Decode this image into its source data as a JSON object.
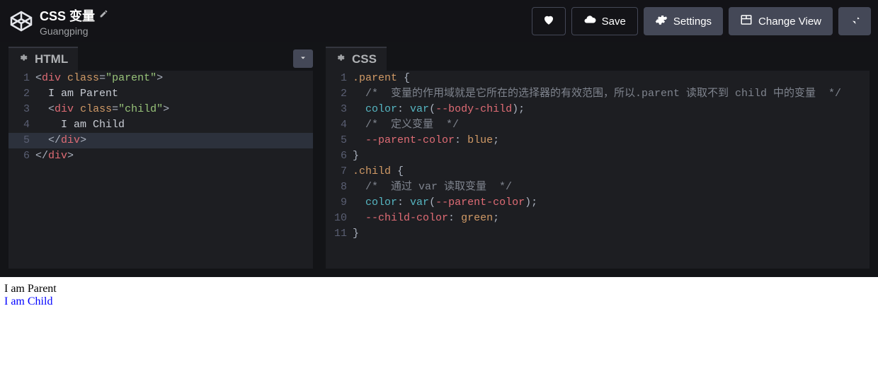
{
  "header": {
    "title": "CSS 变量",
    "author": "Guangping",
    "buttons": {
      "save": "Save",
      "settings": "Settings",
      "changeView": "Change View"
    }
  },
  "panels": {
    "html": {
      "title": "HTML"
    },
    "css": {
      "title": "CSS"
    }
  },
  "htmlCode": {
    "l1_tag_open_lt": "<",
    "l1_tag_name": "div",
    "l1_attr": "class",
    "l1_eq": "=",
    "l1_val": "\"parent\"",
    "l1_gt": ">",
    "l2_text": "  I am Parent",
    "l3_indent": "  ",
    "l3_lt": "<",
    "l3_tag": "div",
    "l3_attr": "class",
    "l3_eq": "=",
    "l3_val": "\"child\"",
    "l3_gt": ">",
    "l4_text": "    I am Child",
    "l5_indent": "  ",
    "l5_lt": "<",
    "l5_slash": "/",
    "l5_tag": "div",
    "l5_gt": ">",
    "l6_lt": "<",
    "l6_slash": "/",
    "l6_tag": "div",
    "l6_gt": ">"
  },
  "cssCode": {
    "l1_sel": ".parent",
    "l1_sp": " ",
    "l1_brace": "{",
    "l2_indent": "  ",
    "l2_cmt": "/*  变量的作用域就是它所在的选择器的有效范围，所以.parent 读取不到 child 中的变量  */",
    "l3_indent": "  ",
    "l3_prop": "color",
    "l3_colon": ": ",
    "l3_fn": "var",
    "l3_lp": "(",
    "l3_var": "--body-child",
    "l3_rp": ")",
    "l3_semi": ";",
    "l4_indent": "  ",
    "l4_cmt": "/*  定义变量  */",
    "l5_indent": "  ",
    "l5_var": "--parent-color",
    "l5_colon": ": ",
    "l5_val": "blue",
    "l5_semi": ";",
    "l6_brace": "}",
    "l7_sel": ".child",
    "l7_sp": " ",
    "l7_brace": "{",
    "l8_indent": "  ",
    "l8_cmt": "/*  通过 var 读取变量  */",
    "l9_indent": "  ",
    "l9_prop": "color",
    "l9_colon": ": ",
    "l9_fn": "var",
    "l9_lp": "(",
    "l9_var": "--parent-color",
    "l9_rp": ")",
    "l9_semi": ";",
    "l10_indent": "  ",
    "l10_var": "--child-color",
    "l10_colon": ": ",
    "l10_val": "green",
    "l10_semi": ";",
    "l11_brace": "}"
  },
  "lineNumbers": {
    "h1": "1",
    "h2": "2",
    "h3": "3",
    "h4": "4",
    "h5": "5",
    "h6": "6",
    "c1": "1",
    "c2": "2",
    "c3": "3",
    "c4": "4",
    "c5": "5",
    "c6": "6",
    "c7": "7",
    "c8": "8",
    "c9": "9",
    "c10": "10",
    "c11": "11"
  },
  "preview": {
    "line1": "I am Parent",
    "line2": "I am Child"
  }
}
